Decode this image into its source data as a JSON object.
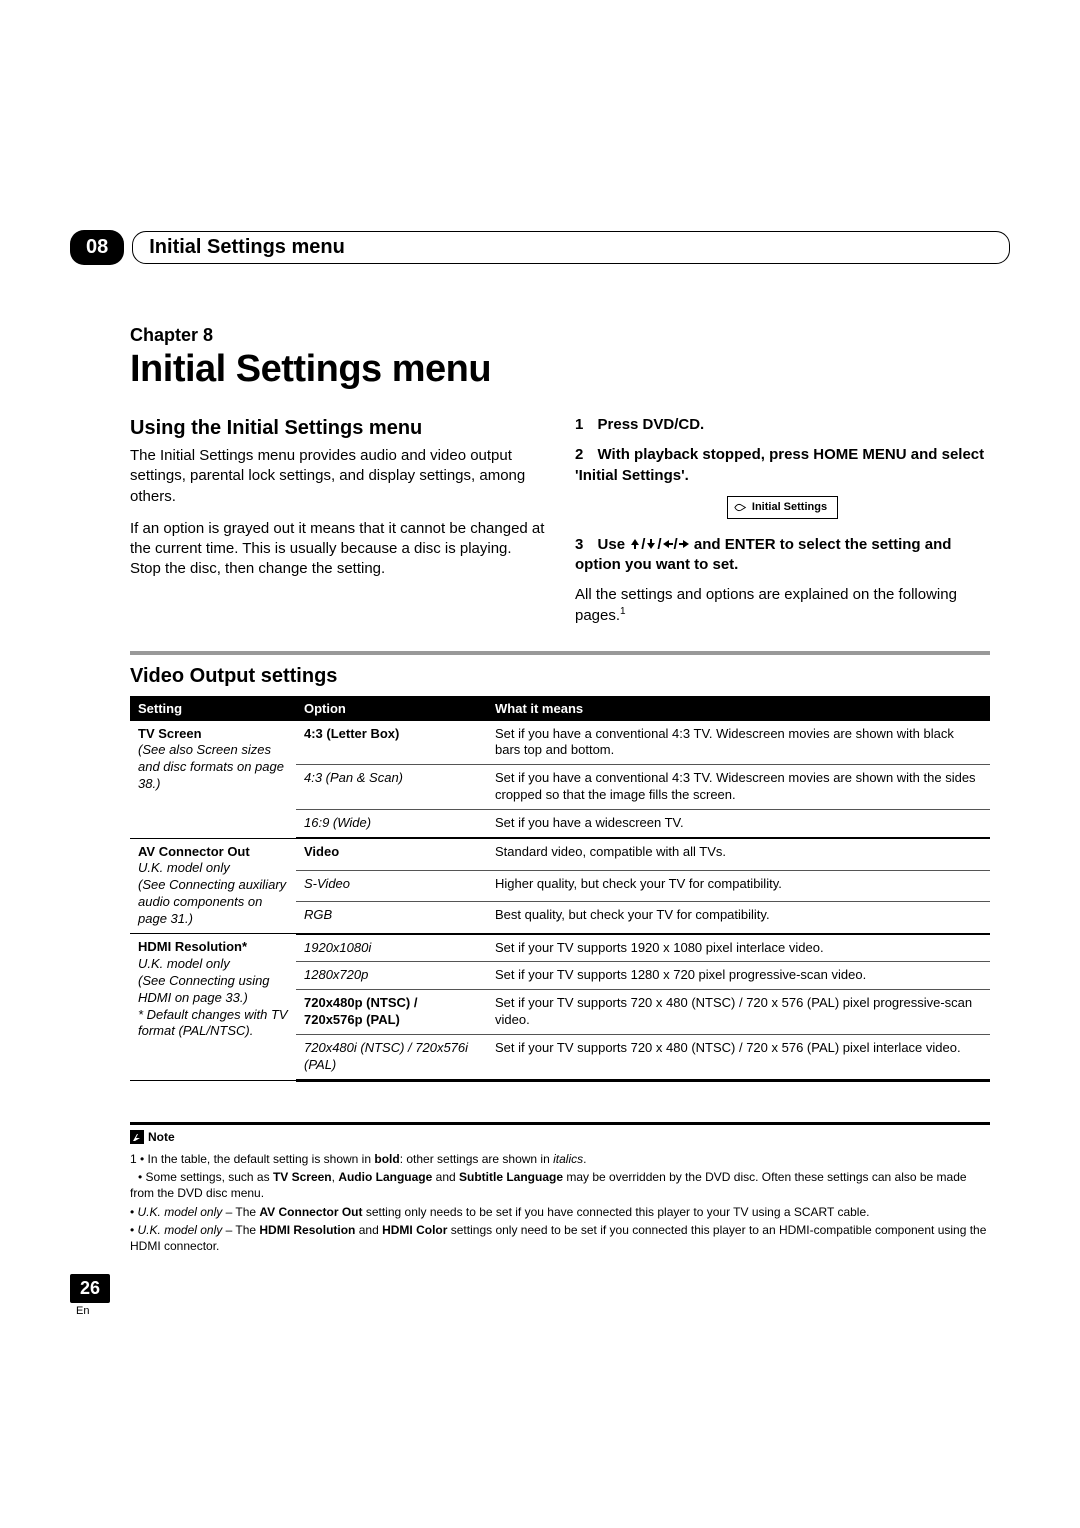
{
  "header": {
    "chapter_num": "08",
    "chapter_bar_title": "Initial Settings menu"
  },
  "chapter": {
    "label": "Chapter 8",
    "title": "Initial Settings menu"
  },
  "left_col": {
    "heading": "Using the Initial Settings menu",
    "para1": "The Initial Settings menu provides audio and video output settings, parental lock settings, and display settings, among others.",
    "para2": "If an option is grayed out it means that it cannot be changed at the current time. This is usually because a disc is playing. Stop the disc, then change the setting."
  },
  "right_col": {
    "step1_num": "1",
    "step1": "Press DVD/CD.",
    "step2_num": "2",
    "step2": "With playback stopped, press HOME MENU and select 'Initial Settings'.",
    "menu_box_label": "Initial Settings",
    "step3_num": "3",
    "step3_prefix": "Use  ",
    "step3_suffix": "  and ENTER to select the setting and option you want to set.",
    "step3_desc": "All the settings and options are explained on the following pages.",
    "footnote_marker": "1"
  },
  "video_section": {
    "heading": "Video Output settings",
    "thead": {
      "c1": "Setting",
      "c2": "Option",
      "c3": "What it means"
    },
    "groups": [
      {
        "setting_name": "TV Screen",
        "setting_note_pre": "(See also ",
        "setting_note_italic": "Screen sizes and disc formats",
        "setting_note_post": " on page 38.)",
        "rows": [
          {
            "option": "4:3 (Letter Box)",
            "option_bold": true,
            "meaning": "Set if you have a conventional 4:3 TV. Widescreen movies are shown with black bars top and bottom."
          },
          {
            "option": "4:3 (Pan & Scan)",
            "option_italic": true,
            "meaning": "Set if you have a conventional 4:3 TV. Widescreen movies are shown with the sides cropped so that the image fills the screen."
          },
          {
            "option": "16:9 (Wide)",
            "option_italic": true,
            "meaning": "Set if you have a widescreen TV."
          }
        ]
      },
      {
        "setting_name": "AV Connector Out",
        "setting_note_pre": "",
        "setting_note_italic": "U.K. model only",
        "setting_note_post": "",
        "setting_note2_pre": "(See ",
        "setting_note2_italic": "Connecting auxiliary audio components",
        "setting_note2_post": " on page 31.)",
        "rows": [
          {
            "option": "Video",
            "option_bold": true,
            "meaning": "Standard video, compatible with all TVs."
          },
          {
            "option": "S-Video",
            "option_italic": true,
            "meaning": "Higher quality, but check your TV for compatibility."
          },
          {
            "option": "RGB",
            "option_italic": true,
            "meaning": "Best quality, but check your TV for compatibility."
          }
        ]
      },
      {
        "setting_name": "HDMI Resolution*",
        "setting_note_pre": "",
        "setting_note_italic": "U.K. model only",
        "setting_note_post": "",
        "setting_note2_pre": "(See ",
        "setting_note2_italic": "Connecting using HDMI",
        "setting_note2_post": " on page 33.)",
        "setting_note3_pre": "* ",
        "setting_note3_italic": "Default changes with TV format (PAL/NTSC).",
        "rows": [
          {
            "option": "1920x1080i",
            "option_italic": true,
            "meaning": "Set if your TV supports 1920 x 1080 pixel interlace video."
          },
          {
            "option": "1280x720p",
            "option_italic": true,
            "meaning": "Set if your TV supports 1280 x 720 pixel progressive-scan video."
          },
          {
            "option": "720x480p (NTSC) / 720x576p (PAL)",
            "option_bold": true,
            "meaning": "Set if your TV supports 720 x 480 (NTSC) / 720 x 576 (PAL) pixel progressive-scan video."
          },
          {
            "option": "720x480i (NTSC) / 720x576i (PAL)",
            "option_italic": true,
            "meaning": "Set if your TV supports 720 x 480 (NTSC) / 720 x 576 (PAL) pixel interlace video."
          }
        ]
      }
    ]
  },
  "notes": {
    "label": "Note",
    "n1_pre": "1 • In the table, the default setting is shown in ",
    "n1_bold": "bold",
    "n1_mid": ": other settings are shown in ",
    "n1_italic": "italics",
    "n1_post": ".",
    "n2_pre": "• Some settings, such as ",
    "n2_b1": "TV Screen",
    "n2_m1": ", ",
    "n2_b2": "Audio Language",
    "n2_m2": " and ",
    "n2_b3": "Subtitle Language",
    "n2_post": " may be overridden by the DVD disc. Often these settings can also be made from the DVD disc menu.",
    "n3_pre": "• ",
    "n3_italic": "U.K. model only",
    "n3_mid": " – The ",
    "n3_bold": "AV Connector Out",
    "n3_post": " setting only needs to be set if you have connected this player to your TV using a SCART cable.",
    "n4_pre": "• ",
    "n4_italic": "U.K. model only",
    "n4_mid": " – The ",
    "n4_b1": "HDMI Resolution",
    "n4_m1": " and ",
    "n4_b2": "HDMI Color",
    "n4_post": " settings only need to be set if you connected this player to an HDMI-compatible component using the HDMI connector."
  },
  "footer": {
    "page_num": "26",
    "lang": "En"
  }
}
